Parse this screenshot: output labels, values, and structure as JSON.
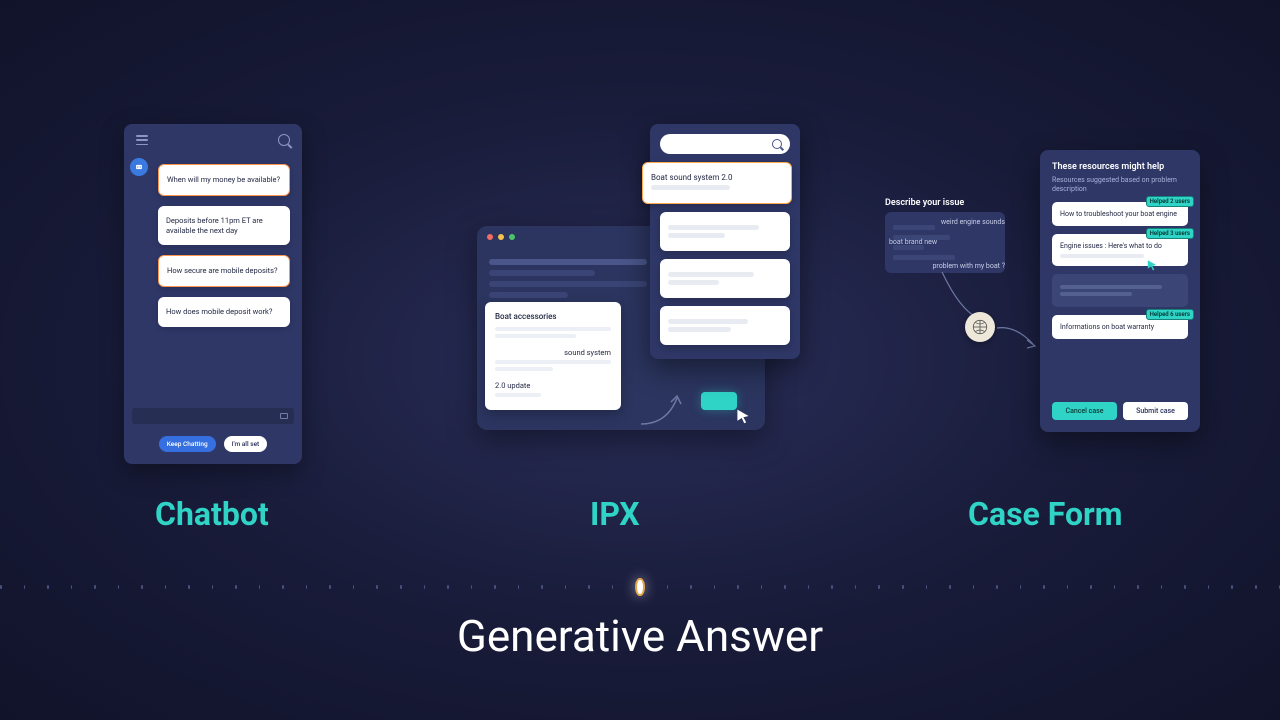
{
  "labels": {
    "chatbot": "Chatbot",
    "ipx": "IPX",
    "caseform": "Case Form",
    "main_title": "Generative Answer"
  },
  "chatbot": {
    "messages": [
      "When will my money be available?",
      "Deposits before 11pm ET are available the next day",
      "How secure are mobile deposits?",
      "How does mobile deposit work?"
    ],
    "keep_chatting": "Keep Chatting",
    "all_set": "I'm all set"
  },
  "ipx": {
    "result_primary": "Boat sound system 2.0",
    "card_title": "Boat accessories",
    "card_line1": "sound system",
    "card_line2": "2.0 update"
  },
  "caseform": {
    "describe_label": "Describe your issue",
    "note1": "weird engine sounds",
    "note2": "boat brand new",
    "note3": "problem with my boat ?",
    "heading": "These resources might help",
    "subheading": "Resources suggested based on problem description",
    "res1": "How to troubleshoot your boat engine",
    "res2": "Engine issues : Here's what to do",
    "res3": "Informations on boat warranty",
    "badge1": "Helped 2 users",
    "badge2": "Helped 3 users",
    "badge3": "Helped 6 users",
    "cancel": "Cancel case",
    "submit": "Submit case"
  }
}
